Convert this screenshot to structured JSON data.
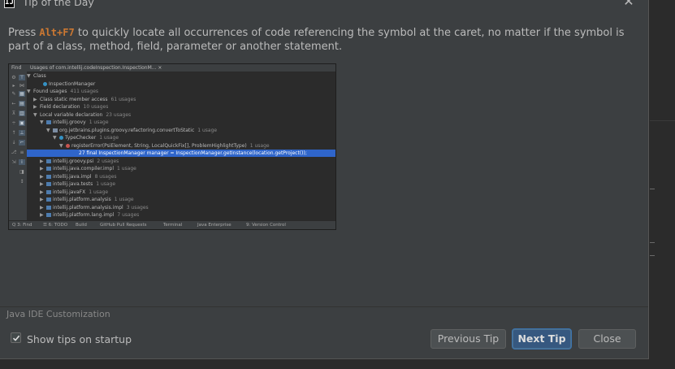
{
  "dialog": {
    "title": "Tip of the Day",
    "app_icon_letter": "IJ"
  },
  "tip": {
    "before": "Press ",
    "shortcut": "Alt+F7",
    "after": " to quickly locate all occurrences of code referencing the symbol at the caret, no matter if the symbol is part of a class, method, field, parameter or another statement."
  },
  "screenshot": {
    "tabs": [
      "Find",
      "Usages of com.intellij.codeInspection.InspectionM... ×"
    ],
    "tree": [
      {
        "arrow": "▼",
        "text": "Class",
        "count": "",
        "icon": ""
      },
      {
        "arrow": "",
        "text": "InspectionManager",
        "count": "",
        "icon": "c"
      },
      {
        "arrow": "▼",
        "text": "Found usages",
        "count": "411 usages",
        "icon": ""
      },
      {
        "arrow": "▶",
        "text": "Class static member access",
        "count": "61 usages",
        "icon": ""
      },
      {
        "arrow": "▶",
        "text": "Field declaration",
        "count": "10 usages",
        "icon": ""
      },
      {
        "arrow": "▼",
        "text": "Local variable declaration",
        "count": "23 usages",
        "icon": ""
      },
      {
        "arrow": "▼",
        "text": "intellij.groovy",
        "count": "1 usage",
        "icon": "sq"
      },
      {
        "arrow": "▼",
        "text": "org.jetbrains.plugins.groovy.refactoring.convertToStatic",
        "count": "1 usage",
        "icon": "pkg"
      },
      {
        "arrow": "▼",
        "text": "TypeChecker",
        "count": "1 usage",
        "icon": "c"
      },
      {
        "arrow": "▼",
        "text": "registerError(PsiElement, String, LocalQuickFix[], ProblemHighlightType)",
        "count": "1 usage",
        "icon": "red"
      },
      {
        "arrow": "",
        "text": "27 final InspectionManager manager = InspectionManager.getInstance(location.getProject());",
        "count": "",
        "icon": "",
        "selected": true
      },
      {
        "arrow": "▶",
        "text": "intellij.groovy.psi",
        "count": "2 usages",
        "icon": "sq"
      },
      {
        "arrow": "▶",
        "text": "intellij.java.compiler.impl",
        "count": "1 usage",
        "icon": "sq"
      },
      {
        "arrow": "▶",
        "text": "intellij.java.impl",
        "count": "8 usages",
        "icon": "sq"
      },
      {
        "arrow": "▶",
        "text": "intellij.java.tests",
        "count": "1 usage",
        "icon": "sq"
      },
      {
        "arrow": "▶",
        "text": "intellij.javaFX",
        "count": "1 usage",
        "icon": "sq"
      },
      {
        "arrow": "▶",
        "text": "intellij.platform.analysis",
        "count": "1 usage",
        "icon": "sq"
      },
      {
        "arrow": "▶",
        "text": "intellij.platform.analysis.impl",
        "count": "3 usages",
        "icon": "sq"
      },
      {
        "arrow": "▶",
        "text": "intellij.platform.lang.impl",
        "count": "7 usages",
        "icon": "sq"
      }
    ],
    "bottom_bar": [
      "Q 3: Find",
      "☰ 6: TODO",
      "Build",
      "GitHub Pull Requests",
      "Terminal",
      "Java Enterprise",
      "9: Version Control"
    ]
  },
  "footer": {
    "section_label": "Java IDE Customization",
    "show_tips_label": "Show tips on startup",
    "show_tips_checked": true,
    "previous_label": "Previous Tip",
    "next_label": "Next Tip",
    "close_label": "Close"
  }
}
